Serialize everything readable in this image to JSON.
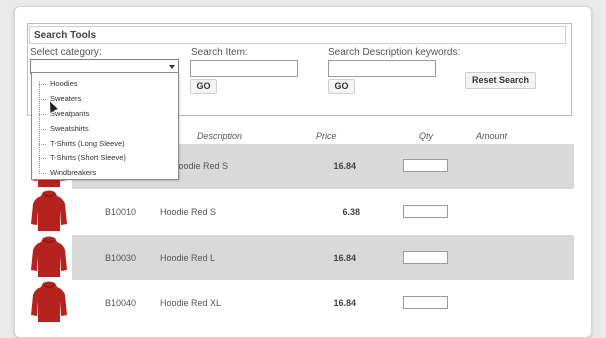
{
  "search": {
    "title": "Search Tools",
    "category_label": "Select category:",
    "item_label": "Search Item:",
    "desc_label": "Search Description keywords:",
    "item_value": "",
    "desc_value": "",
    "category_value": "",
    "go_label": "GO",
    "reset_label": "Reset Search"
  },
  "dropdown": {
    "options": [
      "Hoodies",
      "Sweaters",
      "Sweatpants",
      "Sweatshirts",
      "T-Shirts (Long Sleeve)",
      "T-Shirts (Short Sleeve)",
      "Windbreakers"
    ]
  },
  "table": {
    "headers": {
      "description": "Description",
      "price": "Price",
      "qty": "Qty",
      "amount": "Amount"
    },
    "rows": [
      {
        "code": "",
        "description": "Hoodie Red S",
        "price": "16.84"
      },
      {
        "code": "B10010",
        "description": "Hoodie Red S",
        "price": "6.38"
      },
      {
        "code": "B10030",
        "description": "Hoodie Red L",
        "price": "16.84"
      },
      {
        "code": "B10040",
        "description": "Hoodie Red XL",
        "price": "16.84"
      }
    ]
  },
  "colors": {
    "product": "#b5231f",
    "row_shade": "#d9d9d9"
  },
  "icons": {
    "product_image": "red-hoodie-icon",
    "select_arrow": "chevron-down-icon",
    "cursor": "mouse-cursor-icon"
  }
}
